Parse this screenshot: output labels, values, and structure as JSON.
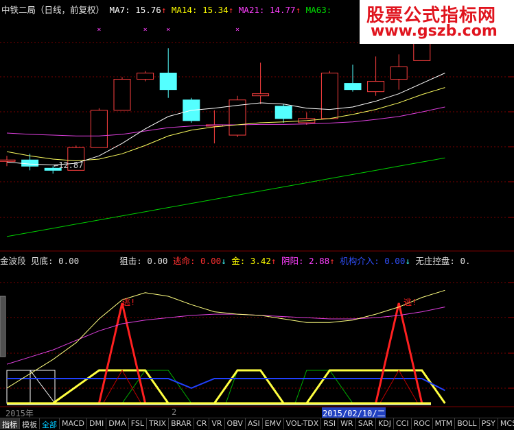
{
  "main_header": {
    "stock": "中铁二局（日线，前复权）",
    "ma7_label": "MA7:",
    "ma7_value": "15.76",
    "ma14_label": "MA14:",
    "ma14_value": "15.34",
    "ma21_label": "MA21:",
    "ma21_value": "14.77",
    "ma63_label": "MA63:",
    "arrow_up": "↑",
    "colors": {
      "ma7": "#ffffff",
      "ma14": "#ffff00",
      "ma21": "#ff40ff",
      "ma63": "#00e000"
    }
  },
  "watermark": {
    "title": "股票公式指标网",
    "url": "www.gszb.com"
  },
  "low_marker": "←12.87",
  "sub_header": {
    "name": "金波段",
    "jiandi_label": "见底:",
    "jiandi_value": "0.00",
    "jugji_label": "狙击:",
    "jugji_value": "0.00",
    "taoming_label": "逃命:",
    "taoming_value": "0.00",
    "jin_label": "金:",
    "jin_value": "3.42",
    "yinyang_label": "阴阳:",
    "yinyang_value": "2.88",
    "jigou_label": "机构介入:",
    "jigou_value": "0.00",
    "wuzhuang_label": "无庄控盘:",
    "wuzhuang_value": "0.",
    "arrow_down": "↓",
    "arrow_up": "↑"
  },
  "escape_labels": [
    "逃!",
    "逃!"
  ],
  "date_strip": {
    "year": "2015年",
    "month": "2",
    "cursor_date": "2015/02/10/二"
  },
  "tabs": [
    "指标",
    "模板",
    "全部",
    "MACD",
    "DMI",
    "DMA",
    "FSL",
    "TRIX",
    "BRAR",
    "CR",
    "VR",
    "OBV",
    "ASI",
    "EMV",
    "VOL-TDX",
    "RSI",
    "WR",
    "SAR",
    "KDJ",
    "CCI",
    "ROC",
    "MTM",
    "BOLL",
    "PSY",
    "MCST"
  ],
  "active_tab": "全部",
  "chart_data": [
    {
      "type": "candlestick",
      "title": "中铁二局（日线，前复权）",
      "candles": [
        {
          "o": 13.2,
          "h": 13.3,
          "l": 13.05,
          "c": 13.2
        },
        {
          "o": 13.2,
          "h": 13.35,
          "l": 12.95,
          "c": 13.05
        },
        {
          "o": 13.0,
          "h": 13.05,
          "l": 12.87,
          "c": 12.95
        },
        {
          "o": 12.95,
          "h": 13.55,
          "l": 12.95,
          "c": 13.5
        },
        {
          "o": 13.5,
          "h": 14.45,
          "l": 13.5,
          "c": 14.4
        },
        {
          "o": 14.4,
          "h": 15.2,
          "l": 14.4,
          "c": 15.15
        },
        {
          "o": 15.15,
          "h": 15.35,
          "l": 15.1,
          "c": 15.3
        },
        {
          "o": 15.3,
          "h": 15.9,
          "l": 14.7,
          "c": 14.9
        },
        {
          "o": 14.65,
          "h": 14.7,
          "l": 14.1,
          "c": 14.15
        },
        {
          "o": 14.05,
          "h": 14.4,
          "l": 13.6,
          "c": 14.05
        },
        {
          "o": 13.8,
          "h": 14.75,
          "l": 13.75,
          "c": 14.65
        },
        {
          "o": 14.75,
          "h": 15.55,
          "l": 14.55,
          "c": 14.8
        },
        {
          "o": 14.5,
          "h": 14.55,
          "l": 14.1,
          "c": 14.2
        },
        {
          "o": 14.1,
          "h": 14.35,
          "l": 14.05,
          "c": 14.2
        },
        {
          "o": 14.2,
          "h": 15.35,
          "l": 14.2,
          "c": 15.3
        },
        {
          "o": 15.05,
          "h": 15.5,
          "l": 14.85,
          "c": 14.9
        },
        {
          "o": 14.85,
          "h": 15.7,
          "l": 14.75,
          "c": 15.1
        },
        {
          "o": 15.15,
          "h": 15.75,
          "l": 14.9,
          "c": 15.45
        },
        {
          "o": 15.6,
          "h": 16.55,
          "l": 15.6,
          "c": 16.5
        },
        {
          "o": 16.4,
          "h": 16.55,
          "l": 16.1,
          "c": 16.2
        }
      ],
      "x_markers": [
        4,
        6,
        7,
        10
      ],
      "ma7": [
        13.15,
        13.1,
        13.08,
        13.12,
        13.3,
        13.6,
        13.95,
        14.25,
        14.4,
        14.45,
        14.52,
        14.58,
        14.55,
        14.45,
        14.42,
        14.48,
        14.62,
        14.8,
        15.05,
        15.3
      ],
      "ma14": [
        13.4,
        13.3,
        13.22,
        13.18,
        13.22,
        13.35,
        13.55,
        13.78,
        13.92,
        14.0,
        14.05,
        14.1,
        14.12,
        14.15,
        14.2,
        14.3,
        14.42,
        14.58,
        14.78,
        14.95
      ],
      "ma21": [
        13.85,
        13.82,
        13.8,
        13.78,
        13.78,
        13.82,
        13.9,
        13.98,
        14.02,
        14.05,
        14.05,
        14.06,
        14.06,
        14.07,
        14.09,
        14.12,
        14.18,
        14.25,
        14.36,
        14.48
      ],
      "ma63": [
        11.35,
        11.45,
        11.55,
        11.65,
        11.75,
        11.85,
        11.95,
        12.05,
        12.15,
        12.25,
        12.35,
        12.45,
        12.55,
        12.65,
        12.75,
        12.85,
        12.95,
        13.05,
        13.15,
        13.25
      ],
      "ylim": [
        11.1,
        16.7
      ]
    },
    {
      "type": "line",
      "title": "金波段",
      "yellow_curve": [
        10,
        22,
        34,
        48,
        68,
        84,
        90,
        87,
        80,
        74,
        72,
        71,
        68,
        65,
        65,
        67,
        72,
        78,
        86,
        92
      ],
      "magenta_curve": [
        30,
        36,
        42,
        50,
        58,
        64,
        67,
        69,
        71,
        72,
        72,
        71,
        70,
        69,
        68,
        68,
        69,
        71,
        74,
        78
      ],
      "red_spikes": [
        5,
        17
      ],
      "trapezoid_yellow": [
        [
          2,
          4,
          6,
          7
        ],
        [
          9,
          10,
          11,
          12
        ],
        [
          13,
          14,
          18,
          19
        ]
      ],
      "blue_line": [
        18,
        18,
        18,
        18,
        18,
        18,
        18,
        18,
        10,
        18,
        18,
        18,
        18,
        18,
        18,
        18,
        18,
        18,
        18,
        8
      ],
      "ylim": [
        -5,
        110
      ]
    }
  ]
}
